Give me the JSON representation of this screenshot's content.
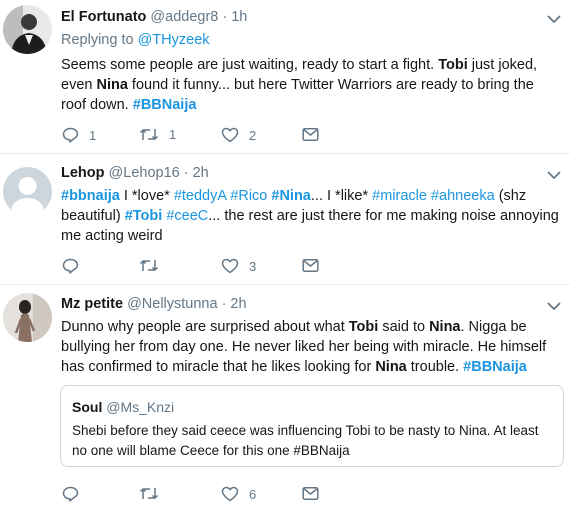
{
  "tweets": [
    {
      "name": "El Fortunato",
      "handle": "@addegr8",
      "time": "· 1h",
      "reply_prefix": "Replying to ",
      "reply_mention": "@THyzeek",
      "text": [
        {
          "t": "Seems some people are just waiting, ready to start a fight. "
        },
        {
          "t": "Tobi",
          "b": true
        },
        {
          "t": " just joked, even "
        },
        {
          "t": "Nina",
          "b": true
        },
        {
          "t": " found it funny... but here Twitter Warriors are ready to bring the roof down. "
        },
        {
          "t": "#BBNaija",
          "link": true,
          "b": true
        }
      ],
      "replies": "1",
      "retweets": "1",
      "likes": "2"
    },
    {
      "name": "Lehop",
      "handle": "@Lehop16",
      "time": "· 2h",
      "text": [
        {
          "t": "#bbnaija",
          "link": true,
          "b": true
        },
        {
          "t": " I *love* "
        },
        {
          "t": "#teddyA",
          "link": true
        },
        {
          "t": " "
        },
        {
          "t": "#Rico",
          "link": true
        },
        {
          "t": " "
        },
        {
          "t": "#Nina",
          "link": true,
          "b": true
        },
        {
          "t": "... I *like* "
        },
        {
          "t": "#miracle",
          "link": true
        },
        {
          "t": " "
        },
        {
          "t": "#ahneeka",
          "link": true
        },
        {
          "t": " (shz beautiful) "
        },
        {
          "t": "#Tobi",
          "link": true,
          "b": true
        },
        {
          "t": " "
        },
        {
          "t": "#ceeC",
          "link": true
        },
        {
          "t": "... the rest are just there for me making noise annoying me acting weird"
        }
      ],
      "replies": "",
      "retweets": "",
      "likes": "3"
    },
    {
      "name": "Mz petite",
      "handle": "@Nellystunna",
      "time": "· 2h",
      "text": [
        {
          "t": "Dunno why people are surprised about what "
        },
        {
          "t": "Tobi",
          "b": true
        },
        {
          "t": " said to "
        },
        {
          "t": "Nina",
          "b": true
        },
        {
          "t": ". Nigga be bullying her from day one. He never liked her being with miracle. He himself has confirmed to miracle that he likes looking for "
        },
        {
          "t": "Nina",
          "b": true
        },
        {
          "t": " trouble. "
        },
        {
          "t": "#BBNaija",
          "link": true,
          "b": true
        }
      ],
      "quote": {
        "name": "Soul",
        "handle": "@Ms_Knzi",
        "text": "Shebi before they said ceece  was influencing  Tobi  to be nasty to Nina. At least no one will blame Ceece  for this one #BBNaija"
      },
      "replies": "",
      "retweets": "",
      "likes": "6"
    }
  ],
  "colors": {
    "link": "#1b95e0",
    "muted": "#657786",
    "divider": "#e6ecf0"
  },
  "icons": [
    "reply-icon",
    "retweet-icon",
    "like-icon",
    "message-icon",
    "chevron-down-icon"
  ]
}
